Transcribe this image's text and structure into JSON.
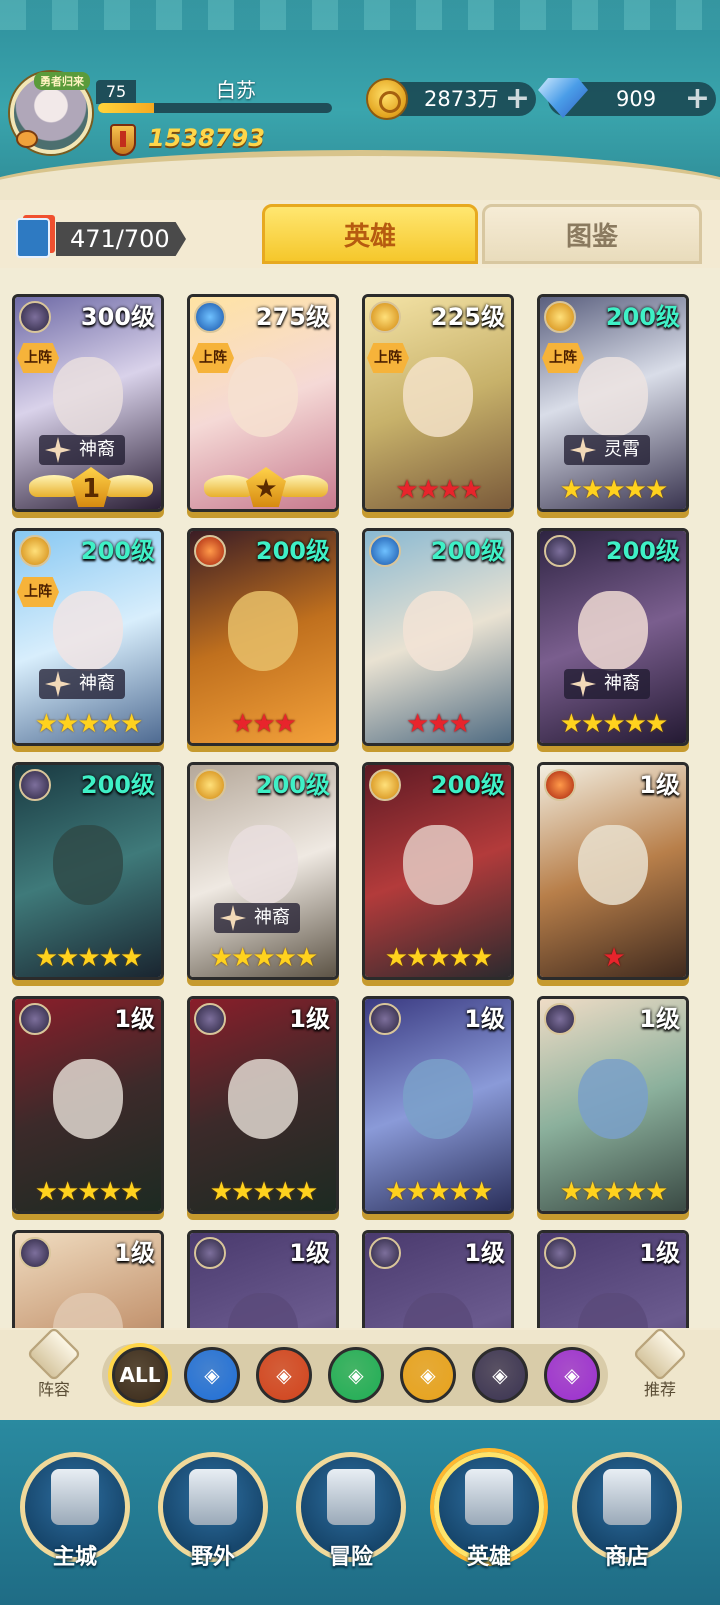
{
  "player": {
    "avatar_badge": "勇者归来",
    "level": "75",
    "name": "白苏",
    "xp_progress": 0.24,
    "power": "1538793"
  },
  "resources": {
    "gold": "2873万",
    "gems": "909"
  },
  "cards_count": "471/700",
  "tabs": {
    "heroes": "英雄",
    "codex": "图鉴"
  },
  "heroes": [
    {
      "level": "300级",
      "deployed": "上阵",
      "tag": "神裔",
      "rank": "1",
      "stars": 0,
      "star_color": "none",
      "element": "void"
    },
    {
      "level": "275级",
      "deployed": "上阵",
      "tag": "",
      "rank": "★",
      "stars": 0,
      "star_color": "none",
      "element": "water"
    },
    {
      "level": "225级",
      "deployed": "上阵",
      "tag": "",
      "rank": "",
      "stars": 4,
      "star_color": "red",
      "element": "light"
    },
    {
      "level": "200级",
      "deployed": "上阵",
      "tag": "灵霄",
      "rank": "",
      "stars": 5,
      "star_color": "yellow",
      "element": "light"
    },
    {
      "level": "200级",
      "deployed": "上阵",
      "tag": "神裔",
      "rank": "",
      "stars": 5,
      "star_color": "yellow",
      "element": "light"
    },
    {
      "level": "200级",
      "deployed": "",
      "tag": "",
      "rank": "",
      "stars": 3,
      "star_color": "red",
      "element": "fire"
    },
    {
      "level": "200级",
      "deployed": "",
      "tag": "",
      "rank": "",
      "stars": 3,
      "star_color": "red",
      "element": "water"
    },
    {
      "level": "200级",
      "deployed": "",
      "tag": "神裔",
      "rank": "",
      "stars": 5,
      "star_color": "yellow",
      "element": "void"
    },
    {
      "level": "200级",
      "deployed": "",
      "tag": "",
      "rank": "",
      "stars": 5,
      "star_color": "yellow",
      "element": "void"
    },
    {
      "level": "200级",
      "deployed": "",
      "tag": "神裔",
      "rank": "",
      "stars": 5,
      "star_color": "yellow",
      "element": "light"
    },
    {
      "level": "200级",
      "deployed": "",
      "tag": "",
      "rank": "",
      "stars": 5,
      "star_color": "yellow",
      "element": "light"
    },
    {
      "level": "1级",
      "deployed": "",
      "tag": "",
      "rank": "",
      "stars": 1,
      "star_color": "red",
      "element": "fire"
    },
    {
      "level": "1级",
      "deployed": "",
      "tag": "",
      "rank": "",
      "stars": 5,
      "star_color": "yellow",
      "element": "void"
    },
    {
      "level": "1级",
      "deployed": "",
      "tag": "",
      "rank": "",
      "stars": 5,
      "star_color": "yellow",
      "element": "void"
    },
    {
      "level": "1级",
      "deployed": "",
      "tag": "",
      "rank": "",
      "stars": 5,
      "star_color": "yellow",
      "element": "void"
    },
    {
      "level": "1级",
      "deployed": "",
      "tag": "",
      "rank": "",
      "stars": 5,
      "star_color": "yellow",
      "element": "void"
    },
    {
      "level": "1级",
      "deployed": "",
      "tag": "",
      "rank": "",
      "stars": 0,
      "star_color": "none",
      "element": "void"
    },
    {
      "level": "1级",
      "deployed": "",
      "tag": "",
      "rank": "",
      "stars": 0,
      "star_color": "none",
      "element": "void"
    },
    {
      "level": "1级",
      "deployed": "",
      "tag": "",
      "rank": "",
      "stars": 0,
      "star_color": "none",
      "element": "void"
    },
    {
      "level": "1级",
      "deployed": "",
      "tag": "",
      "rank": "",
      "stars": 0,
      "star_color": "none",
      "element": "void"
    }
  ],
  "filters": {
    "lineup_label": "阵容",
    "recommend_label": "推荐",
    "items": [
      {
        "label": "ALL",
        "icon": "all-icon",
        "color": "#3a2a1a"
      },
      {
        "label": "",
        "icon": "water-element-icon",
        "color": "#1f6fd8"
      },
      {
        "label": "",
        "icon": "fire-element-icon",
        "color": "#d2431d"
      },
      {
        "label": "",
        "icon": "wind-element-icon",
        "color": "#1fae55"
      },
      {
        "label": "",
        "icon": "light-element-icon",
        "color": "#e8a21b"
      },
      {
        "label": "",
        "icon": "void-element-icon",
        "color": "#3a3352"
      },
      {
        "label": "",
        "icon": "arcane-element-icon",
        "color": "#9c2fd1"
      }
    ]
  },
  "nav": [
    {
      "label": "主城",
      "icon": "castle-icon"
    },
    {
      "label": "野外",
      "icon": "portal-icon"
    },
    {
      "label": "冒险",
      "icon": "sword-icon"
    },
    {
      "label": "英雄",
      "icon": "knight-helmet-icon",
      "active": true
    },
    {
      "label": "商店",
      "icon": "shop-icon"
    }
  ]
}
